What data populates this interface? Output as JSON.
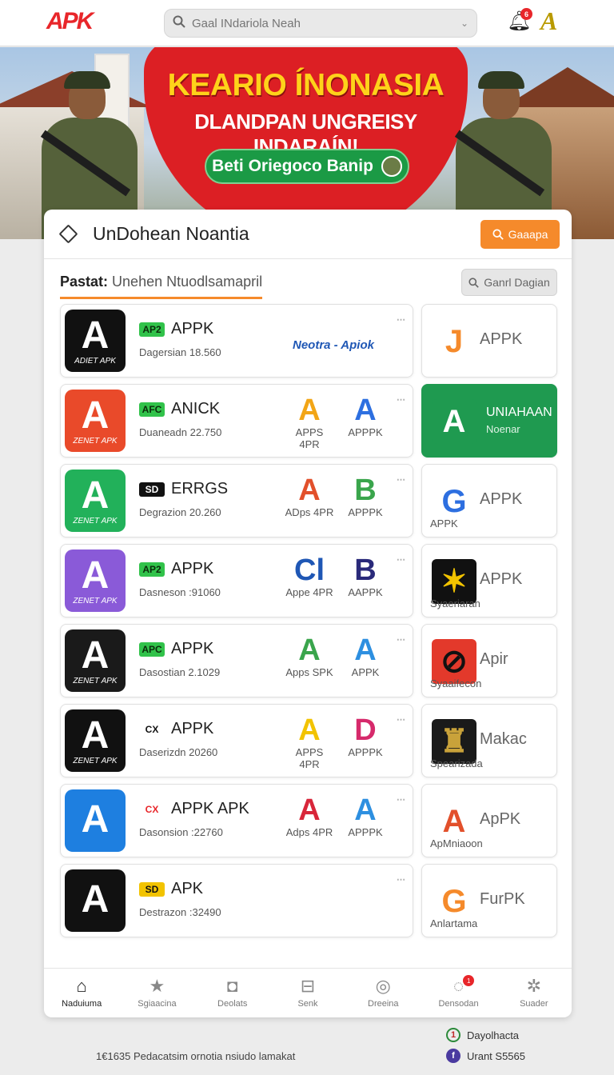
{
  "header": {
    "logo": "APK",
    "search_placeholder": "Gaal INdariola Neah",
    "notification_badge": "6",
    "account_letter": "A"
  },
  "banner": {
    "title_line1": "KEARIO ÍNONASIA",
    "title_line2": "DLANDPAN UNGREISY INDARAÍN!",
    "cta_label": "Beti Oriegoco Banip",
    "colors": {
      "red": "#dc1f24",
      "yellow": "#ffd21a",
      "green": "#1b9a45"
    }
  },
  "panel": {
    "title": "UnDohean Noantia",
    "action_button": "Gaaapa",
    "filter_label": "Pastat:",
    "filter_value": "Unehen Ntuodlsamapril",
    "filter_search": "Ganrl Dagian"
  },
  "apps": [
    {
      "icon_color": "#111111",
      "icon_text": "ADIET APK",
      "tag": "AP2",
      "tag_bg": "#31c24a",
      "tag_fg": "#0a2b0a",
      "name": "APPK",
      "desc": "Dagersian 18.560",
      "brand_text": "Neotra - Apiok",
      "mark1": "",
      "mark1_label": "",
      "mark2": "",
      "mark2_label": "",
      "right": {
        "logo": "J",
        "logo_color": "#f58a2b",
        "logo_bg": "#ffffff",
        "name": "APPK",
        "sub": "",
        "green": false
      }
    },
    {
      "icon_color": "#e94a2a",
      "icon_text": "ZENET APK",
      "tag": "AFC",
      "tag_bg": "#31c24a",
      "tag_fg": "#0a2b0a",
      "name": "ANICK",
      "desc": "Duaneadn 22.750",
      "brand_text": "",
      "mark1": "A",
      "mark1_color": "#f2a516",
      "mark1_label": "APPS 4PR",
      "mark2": "A",
      "mark2_color": "#2d6fe0",
      "mark2_label": "APPPK",
      "right": {
        "logo": "A",
        "logo_color": "#ffffff",
        "logo_bg": "#1f9a50",
        "name": "UNIAHAAN",
        "sub": "Noenar",
        "green": true
      }
    },
    {
      "icon_color": "#22b15a",
      "icon_text": "ZENET APK",
      "tag": "SD",
      "tag_bg": "#111111",
      "tag_fg": "#ffffff",
      "name": "ERRGS",
      "desc": "Degrazion 20.260",
      "brand_text": "",
      "mark1": "A",
      "mark1_color": "#e2502b",
      "mark1_label": "ADps 4PR",
      "mark2": "B",
      "mark2_color": "#3aa54c",
      "mark2_label": "APPPK",
      "right": {
        "logo": "G",
        "logo_color": "#2d6fe0",
        "logo_bg": "#ffffff",
        "name": "APPK",
        "sub": "APPK",
        "green": false
      }
    },
    {
      "icon_color": "#8a5ad8",
      "icon_text": "ZENET APK",
      "tag": "AP2",
      "tag_bg": "#31c24a",
      "tag_fg": "#0a2b0a",
      "name": "APPK",
      "desc": "Dasneson :91060",
      "brand_text": "",
      "mark1": "Cl",
      "mark1_color": "#1f57b5",
      "mark1_label": "Appe 4PR",
      "mark2": "B",
      "mark2_color": "#2a2a7a",
      "mark2_label": "AAPPK",
      "right": {
        "logo": "✶",
        "logo_color": "#f2c300",
        "logo_bg": "#111111",
        "name": "APPK",
        "sub": "Syaeriaran",
        "green": false
      }
    },
    {
      "icon_color": "#1a1a1a",
      "icon_text": "ZENET APK",
      "tag": "APC",
      "tag_bg": "#31c24a",
      "tag_fg": "#0a2b0a",
      "name": "APPK",
      "desc": "Dasostian 2.1029",
      "brand_text": "",
      "mark1": "A",
      "mark1_color": "#3aa54c",
      "mark1_label": "Apps SPK",
      "mark2": "A",
      "mark2_color": "#2d8fe0",
      "mark2_label": "APPK",
      "right": {
        "logo": "⊘",
        "logo_color": "#111111",
        "logo_bg": "#e3392b",
        "name": "Apir",
        "sub": "Syaaifecon",
        "green": false
      }
    },
    {
      "icon_color": "#111111",
      "icon_text": "ZENET APK",
      "tag": "CX",
      "tag_bg": "#ffffff",
      "tag_fg": "#111111",
      "name": "APPK",
      "desc": "Daserizdn 20260",
      "brand_text": "",
      "mark1": "A",
      "mark1_color": "#f2c300",
      "mark1_label": "APPS 4PR",
      "mark2": "D",
      "mark2_color": "#d62a6b",
      "mark2_label": "APPPK",
      "right": {
        "logo": "♜",
        "logo_color": "#c9a23a",
        "logo_bg": "#1a1a1a",
        "name": "Makac",
        "sub": "Spearizada",
        "green": false
      }
    },
    {
      "icon_color": "#1e7fe0",
      "icon_text": "",
      "tag": "CX",
      "tag_bg": "#ffffff",
      "tag_fg": "#e8262a",
      "name": "APPK APK",
      "desc": "Dasonsion :22760",
      "brand_text": "",
      "mark1": "A",
      "mark1_color": "#d8263a",
      "mark1_label": "Adps 4PR",
      "mark2": "A",
      "mark2_color": "#2d8fe0",
      "mark2_label": "APPPK",
      "right": {
        "logo": "A",
        "logo_color": "#e2502b",
        "logo_bg": "#ffffff",
        "name": "ApPK",
        "sub": "ApMniaoon",
        "green": false
      }
    },
    {
      "icon_color": "#111111",
      "icon_text": "",
      "tag": "SD",
      "tag_bg": "#f2c300",
      "tag_fg": "#111111",
      "name": "APK",
      "desc": "Destrazon :32490",
      "brand_text": "",
      "mark1": "",
      "mark1_label": "",
      "mark2": "",
      "mark2_label": "",
      "right": {
        "logo": "G",
        "logo_color": "#f58a2b",
        "logo_bg": "#ffffff",
        "name": "FurPK",
        "sub": "Anlartama",
        "green": false
      }
    }
  ],
  "bottom_nav": [
    {
      "icon": "home-icon",
      "glyph": "⌂",
      "label": "Naduiuma",
      "active": true,
      "badge": ""
    },
    {
      "icon": "star-icon",
      "glyph": "★",
      "label": "Sgiaacina",
      "active": false,
      "badge": ""
    },
    {
      "icon": "camera-icon",
      "glyph": "◘",
      "label": "Deolats",
      "active": false,
      "badge": ""
    },
    {
      "icon": "box-icon",
      "glyph": "⊟",
      "label": "Senk",
      "active": false,
      "badge": ""
    },
    {
      "icon": "settings-icon",
      "glyph": "◎",
      "label": "Dreeina",
      "active": false,
      "badge": ""
    },
    {
      "icon": "chat-icon",
      "glyph": "◌",
      "label": "Densodan",
      "active": false,
      "badge": "1"
    },
    {
      "icon": "gear-icon",
      "glyph": "✲",
      "label": "Suader",
      "active": false,
      "badge": ""
    }
  ],
  "footer": {
    "text": "1€1635 Pedacatsim ornotia nsiudo lamakat",
    "social1_glyph": "1",
    "social1_label": "Dayolhacta",
    "social2_glyph": "f",
    "social2_label": "Urant S5565"
  }
}
